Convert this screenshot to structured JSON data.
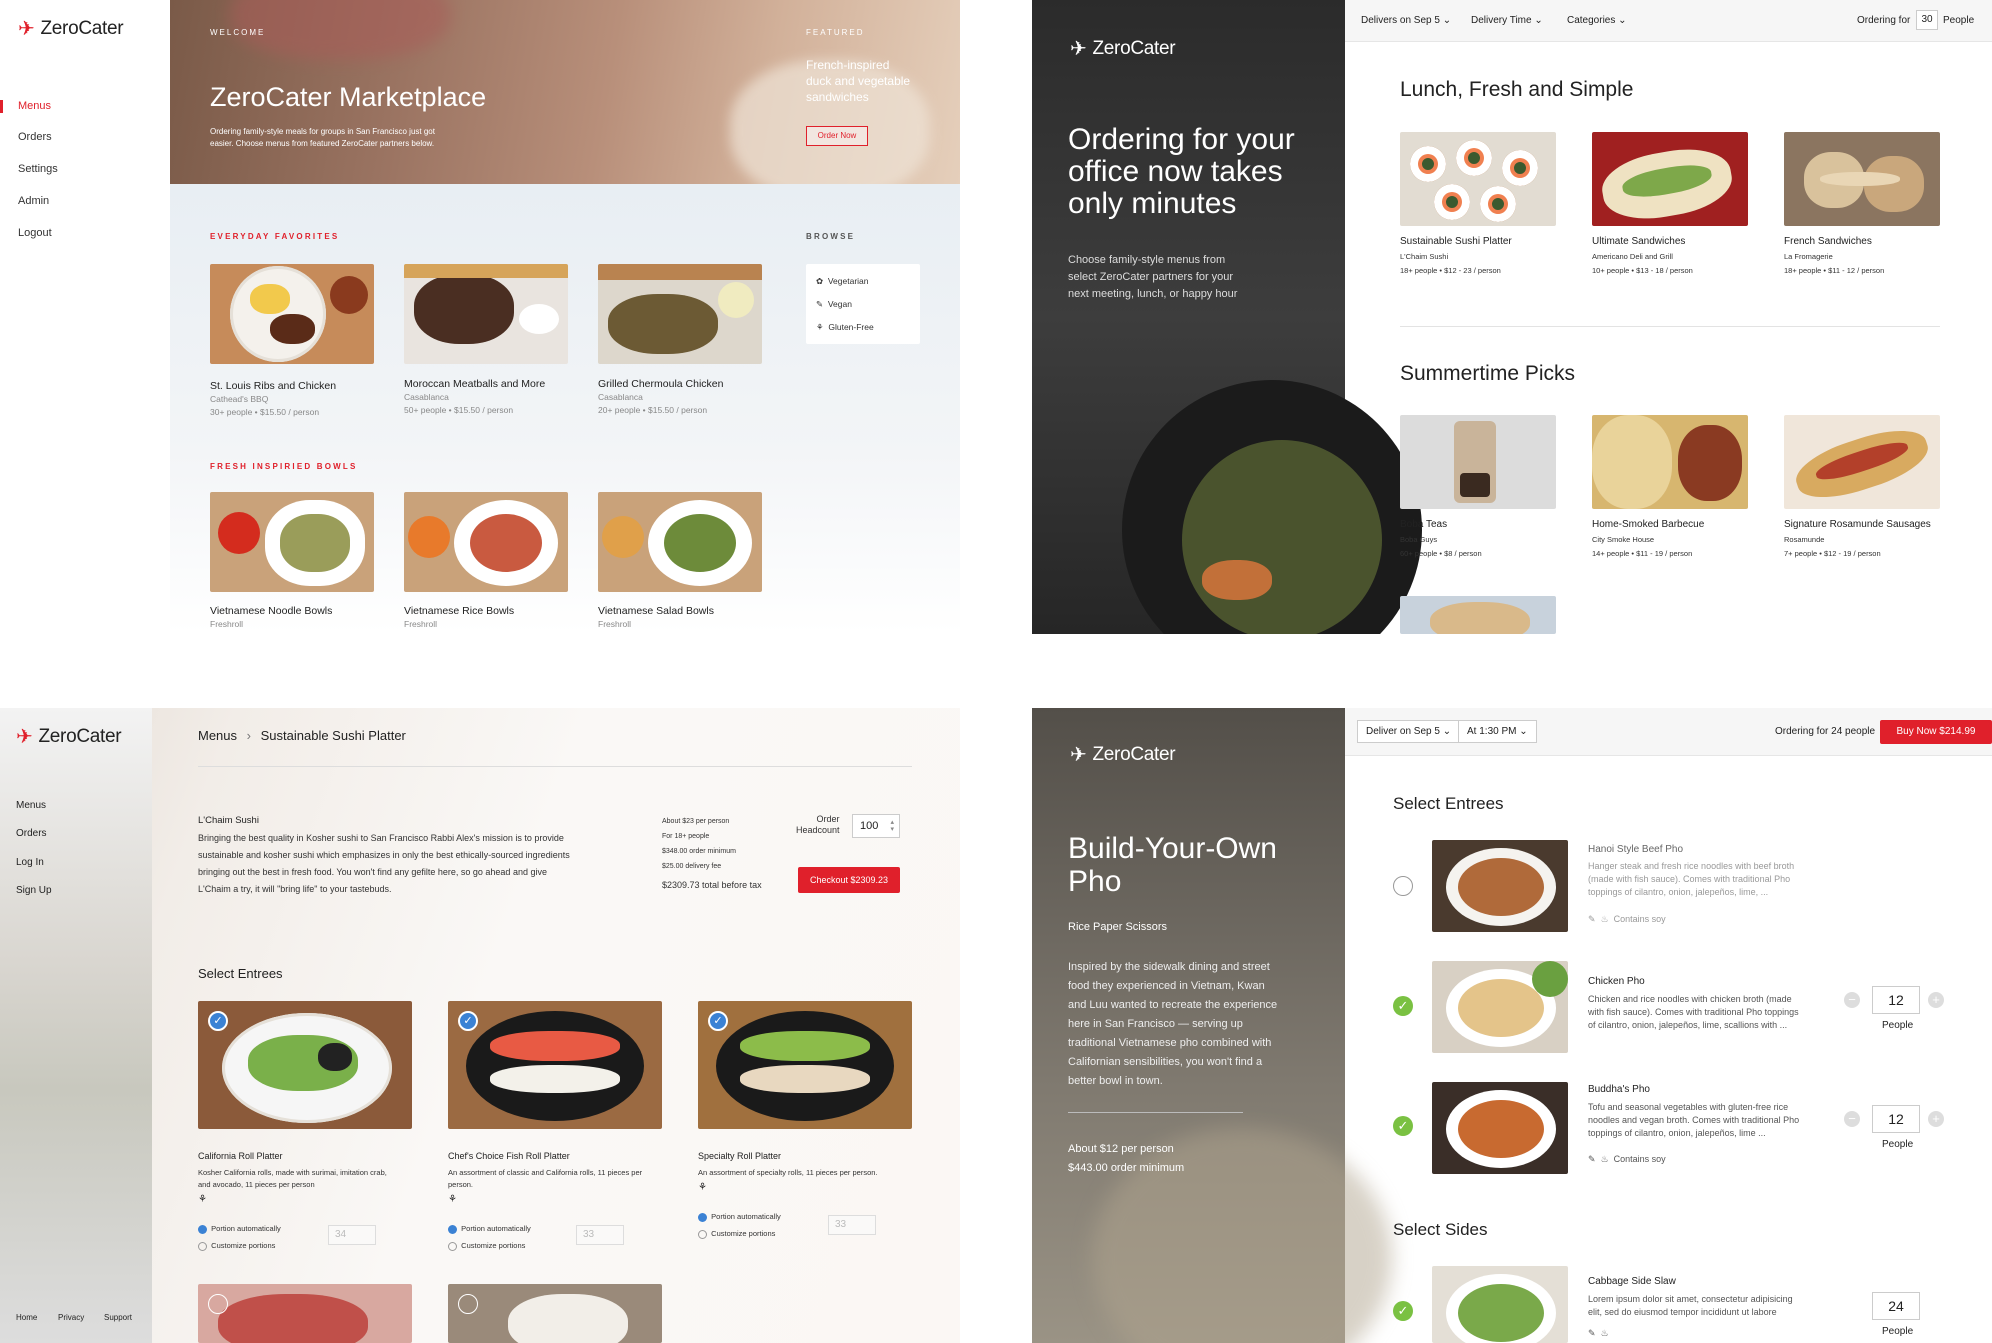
{
  "brand": {
    "name": "ZeroCater",
    "accent": "#e0202b"
  },
  "p1": {
    "nav": [
      "Menus",
      "Orders",
      "Settings",
      "Admin",
      "Logout"
    ],
    "hero": {
      "welcome": "WELCOME",
      "title": "ZeroCater Marketplace",
      "desc1": "Ordering family-style meals for groups in San Francisco just got",
      "desc2": "easier. Choose menus from featured ZeroCater partners below.",
      "featured": "FEATURED",
      "feat1": "French-inspired",
      "feat2": "duck and vegetable",
      "feat3": "sandwiches",
      "btn": "Order Now"
    },
    "sec1": "EVERYDAY FAVORITES",
    "sec2": "FRESH INSPIRIED BOWLS",
    "browse": "BROWSE",
    "browse_items": [
      "Vegetarian",
      "Vegan",
      "Gluten-Free"
    ],
    "cards1": [
      {
        "title": "St. Louis Ribs and Chicken",
        "vendor": "Cathead's BBQ",
        "meta": "30+ people  •  $15.50 / person"
      },
      {
        "title": "Moroccan Meatballs and More",
        "vendor": "Casablanca",
        "meta": "50+ people  •  $15.50 / person"
      },
      {
        "title": "Grilled Chermoula Chicken",
        "vendor": "Casablanca",
        "meta": "20+ people  •  $15.50 / person"
      }
    ],
    "cards2": [
      {
        "title": "Vietnamese Noodle Bowls",
        "vendor": "Freshroll"
      },
      {
        "title": "Vietnamese Rice Bowls",
        "vendor": "Freshroll"
      },
      {
        "title": "Vietnamese Salad Bowls",
        "vendor": "Freshroll"
      }
    ]
  },
  "p2": {
    "topbar": {
      "delivers": "Delivers on Sep 5",
      "time": "Delivery Time",
      "categories": "Categories",
      "ordering_for": "Ordering for",
      "count": "30",
      "people": "People"
    },
    "hero1": "Ordering for your",
    "hero2": "office now takes",
    "hero3": "only minutes",
    "sub1": "Choose family-style menus from",
    "sub2": "select ZeroCater partners for your",
    "sub3": "next meeting, lunch, or happy hour",
    "section1": "Lunch, Fresh and Simple",
    "section2": "Summertime Picks",
    "cards1": [
      {
        "title": "Sustainable Sushi Platter",
        "vendor": "L'Chaim Sushi",
        "meta": "18+ people • $12 - 23 / person"
      },
      {
        "title": "Ultimate Sandwiches",
        "vendor": "Americano Deli and Grill",
        "meta": "10+ people • $13 - 18 / person"
      },
      {
        "title": "French Sandwiches",
        "vendor": "La Fromagerie",
        "meta": "18+ people • $11 - 12 / person"
      }
    ],
    "cards2": [
      {
        "title": "Boba Teas",
        "vendor": "Boba Guys",
        "meta": "60+ people • $8 / person"
      },
      {
        "title": "Home-Smoked Barbecue",
        "vendor": "City Smoke House",
        "meta": "14+ people • $11 - 19 / person"
      },
      {
        "title": "Signature Rosamunde Sausages",
        "vendor": "Rosamunde",
        "meta": "7+ people • $12 - 19 / person"
      }
    ]
  },
  "p3": {
    "nav": [
      "Menus",
      "Orders",
      "Log In",
      "Sign Up"
    ],
    "footer": [
      "Home",
      "Privacy",
      "Support"
    ],
    "breadcrumb_root": "Menus",
    "breadcrumb_current": "Sustainable Sushi Platter",
    "vendor": "L'Chaim Sushi",
    "desc": [
      "Bringing the best quality in Kosher sushi to San Francisco Rabbi Alex's mission is to provide",
      "sustainable and kosher sushi which emphasizes in only the best ethically-sourced ingredients",
      "bringing out the best in fresh food. You won't find any gefilte here, so go ahead and give",
      "L'Chaim a try, it will \"bring life\" to your tastebuds."
    ],
    "pricing": [
      "About $23 per person",
      "For 18+ people",
      "$348.00 order minimum",
      "$25.00 delivery fee"
    ],
    "total": "$2309.73 total before tax",
    "headcount_label1": "Order",
    "headcount_label2": "Headcount",
    "headcount": "100",
    "checkout": "Checkout $2309.23",
    "select_entrees": "Select Entrees",
    "entrees": [
      {
        "title": "California Roll Platter",
        "desc1": "Kosher California rolls, made with surimai, imitation crab,",
        "desc2": "and avocado, 11 pieces per person",
        "qty": "34"
      },
      {
        "title": "Chef's Choice Fish Roll Platter",
        "desc1": "An assortment of classic and California rolls, 11 pieces per",
        "desc2": "person.",
        "qty": "33"
      },
      {
        "title": "Specialty Roll Platter",
        "desc1": "An assortment of specialty rolls, 11 pieces per person.",
        "desc2": "",
        "qty": "33"
      }
    ],
    "portion_auto": "Portion automatically",
    "portion_custom": "Customize portions"
  },
  "p4": {
    "deliver": "Deliver on Sep 5",
    "at": "At 1:30 PM",
    "ordering_for": "Ordering for 24 people",
    "buy": "Buy Now  $214.99",
    "title1": "Build-Your-Own",
    "title2": "Pho",
    "vendor": "Rice Paper Scissors",
    "story": [
      "Inspired by the sidewalk dining and street",
      "food they experienced in Vietnam, Kwan",
      "and Luu wanted to recreate the experience",
      "here in San Francisco — serving up",
      "traditional Vietnamese pho combined with",
      "Californian sensibilities, you won't find a",
      "better bowl in town."
    ],
    "price1": "About $12 per person",
    "price2": "$443.00 order minimum",
    "select_entrees": "Select Entrees",
    "select_sides": "Select Sides",
    "items": [
      {
        "title": "Hanoi Style Beef Pho",
        "d1": "Hanger steak and fresh rice noodles with beef broth",
        "d2": "(made with fish sauce). Comes with traditional Pho",
        "d3": "toppings of cilantro, onion, jalepeños, lime, ...",
        "tag": "Contains soy",
        "qty": ""
      },
      {
        "title": "Chicken Pho",
        "d1": "Chicken and rice noodles with chicken broth (made",
        "d2": "with fish sauce). Comes with traditional Pho toppings",
        "d3": "of cilantro, onion, jalepeños, lime, scallions with ...",
        "tag": "",
        "qty": "12"
      },
      {
        "title": "Buddha's Pho",
        "d1": "Tofu and seasonal vegetables with gluten-free rice",
        "d2": "noodles and vegan broth. Comes with traditional Pho",
        "d3": "toppings of cilantro, onion, jalepeños, lime ...",
        "tag": "Contains soy",
        "qty": "12"
      },
      {
        "title": "Cabbage Side Slaw",
        "d1": "Lorem ipsum dolor sit amet, consectetur adipisicing",
        "d2": "elit, sed do eiusmod tempor incididunt ut labore",
        "d3": "",
        "tag": "",
        "qty": "24"
      }
    ],
    "people": "People"
  }
}
